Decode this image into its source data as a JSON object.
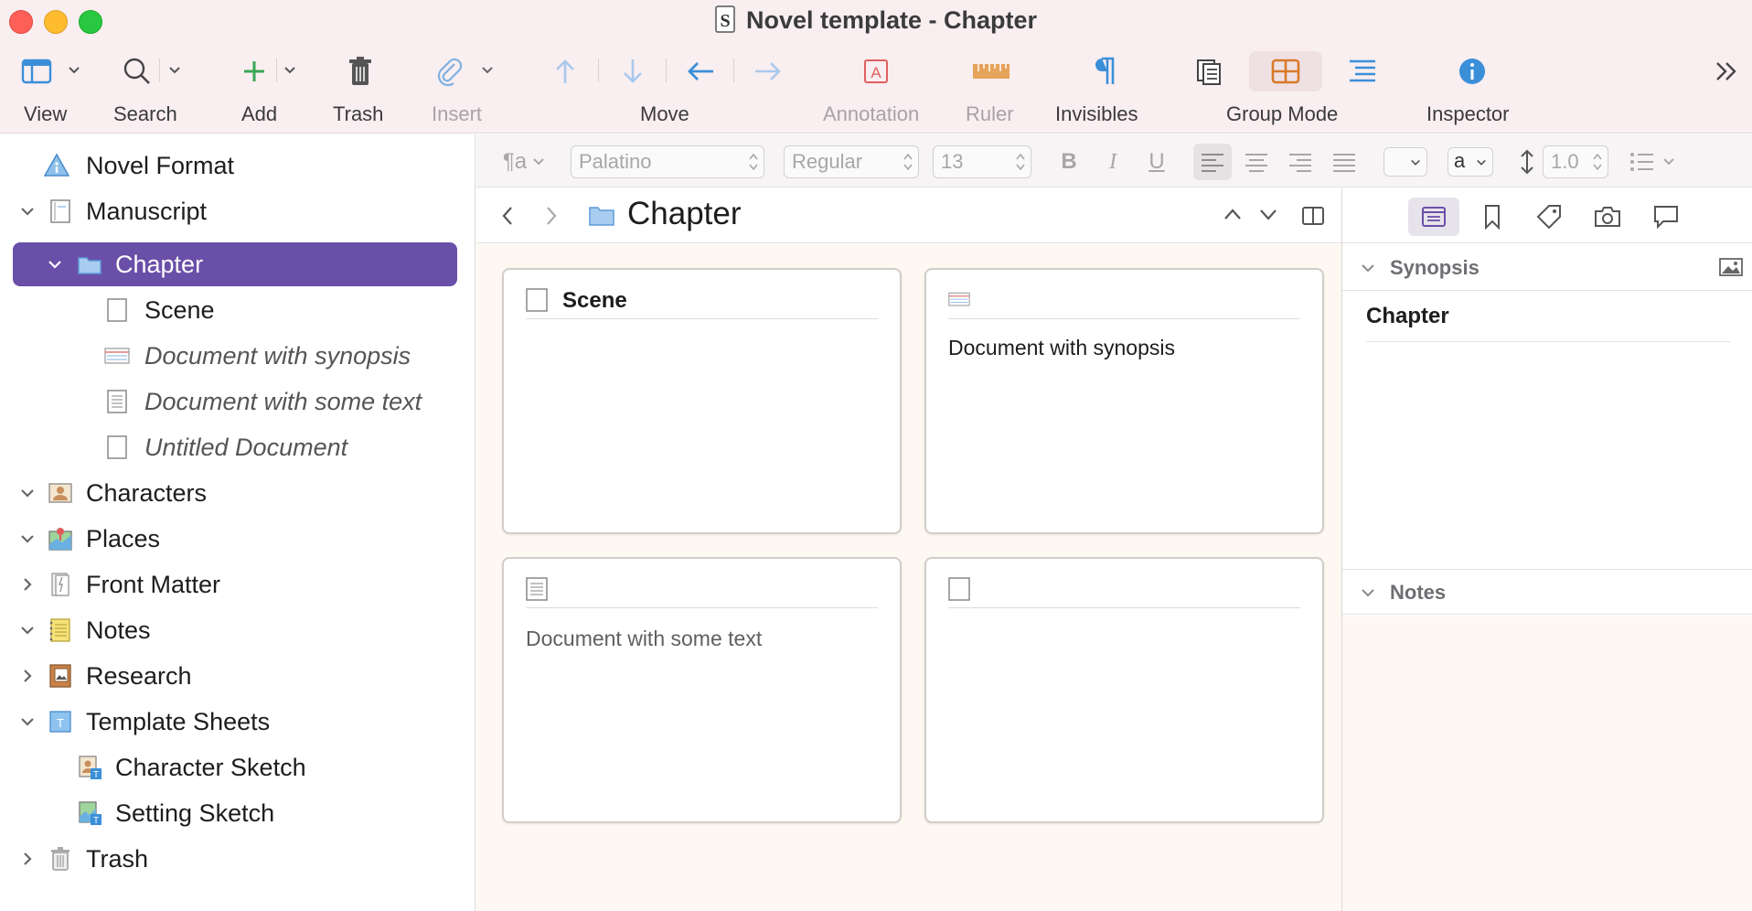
{
  "window": {
    "title": "Novel template - Chapter"
  },
  "toolbar": {
    "view": "View",
    "search": "Search",
    "add": "Add",
    "trash": "Trash",
    "insert": "Insert",
    "move": "Move",
    "annotation": "Annotation",
    "ruler": "Ruler",
    "invisibles": "Invisibles",
    "group_mode": "Group Mode",
    "inspector": "Inspector",
    "overflow_icon": "double-chevron-right-icon"
  },
  "binder": {
    "items": [
      {
        "label": "Novel Format",
        "icon": "info-icon"
      },
      {
        "label": "Manuscript",
        "icon": "manuscript-icon"
      },
      {
        "label": "Chapter",
        "icon": "folder-icon"
      },
      {
        "label": "Scene",
        "icon": "blank-document-icon"
      },
      {
        "label": "Document with synopsis",
        "icon": "synopsis-document-icon"
      },
      {
        "label": "Document with some text",
        "icon": "text-document-icon"
      },
      {
        "label": "Untitled Document",
        "icon": "blank-document-icon"
      },
      {
        "label": "Characters",
        "icon": "characters-folder-icon"
      },
      {
        "label": "Places",
        "icon": "places-folder-icon"
      },
      {
        "label": "Front Matter",
        "icon": "front-matter-icon"
      },
      {
        "label": "Notes",
        "icon": "notes-notebook-icon"
      },
      {
        "label": "Research",
        "icon": "research-icon"
      },
      {
        "label": "Template Sheets",
        "icon": "template-folder-icon"
      },
      {
        "label": "Character Sketch",
        "icon": "character-sketch-icon"
      },
      {
        "label": "Setting Sketch",
        "icon": "setting-sketch-icon"
      },
      {
        "label": "Trash",
        "icon": "trash-icon"
      }
    ]
  },
  "formatbar": {
    "paragraph_style": "¶a",
    "font": "Palatino",
    "weight": "Regular",
    "size": "13",
    "bold": "B",
    "italic": "I",
    "underline": "U",
    "highlight": "a",
    "line_spacing": "1.0"
  },
  "editor": {
    "title": "Chapter",
    "cards": [
      {
        "title": "Scene",
        "body": ""
      },
      {
        "title": "",
        "body": "Document with synopsis"
      },
      {
        "title": "",
        "body": "Document with some text"
      },
      {
        "title": "",
        "body": ""
      }
    ]
  },
  "inspector": {
    "synopsis_header": "Synopsis",
    "synopsis_text": "Chapter",
    "notes_header": "Notes"
  },
  "colors": {
    "accent": "#6a4fa8",
    "toolbar_bg": "#f9eef0",
    "corkboard_bg": "#fdf8f1"
  }
}
